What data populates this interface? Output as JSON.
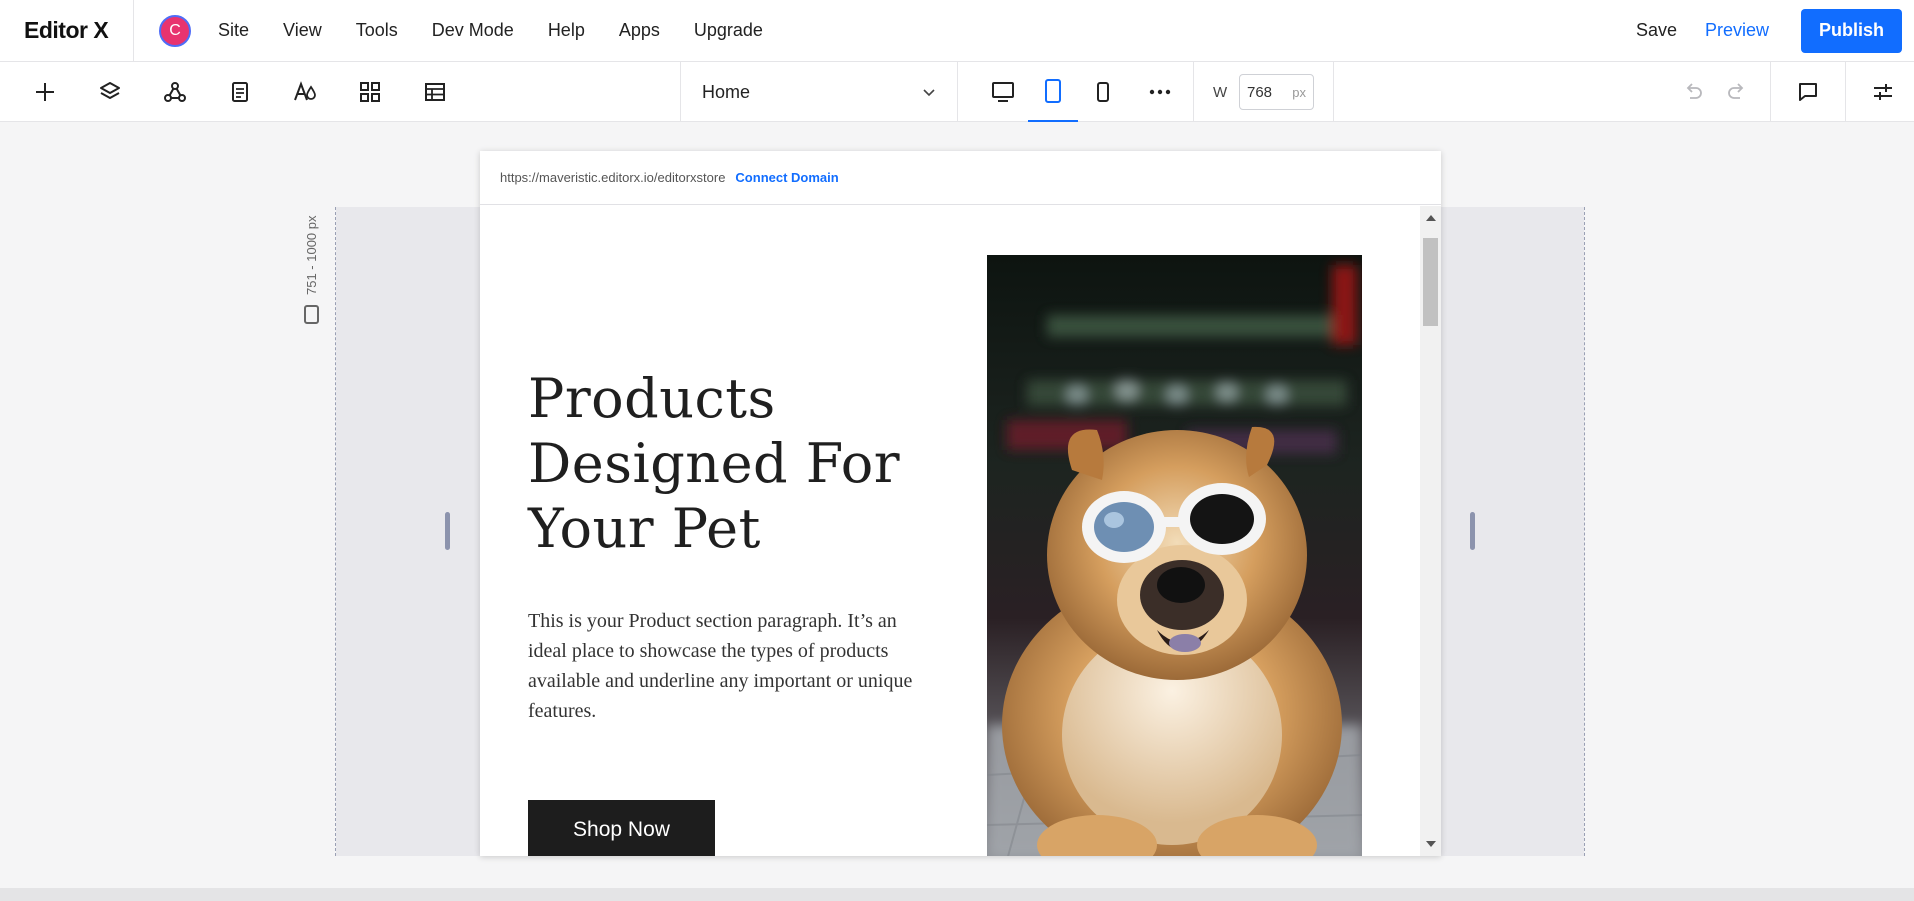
{
  "app": {
    "logo": "Editor X",
    "avatar_letter": "C"
  },
  "menu": [
    {
      "label": "Site"
    },
    {
      "label": "View"
    },
    {
      "label": "Tools"
    },
    {
      "label": "Dev Mode"
    },
    {
      "label": "Help"
    },
    {
      "label": "Apps"
    },
    {
      "label": "Upgrade"
    }
  ],
  "actions": {
    "save": "Save",
    "preview": "Preview",
    "publish": "Publish"
  },
  "toolbar": {
    "tools": [
      "plus-icon",
      "layers-icon",
      "connect-icon",
      "page-icon",
      "theme-icon",
      "apps-grid-icon",
      "table-icon"
    ],
    "page": "Home",
    "width_label": "W",
    "width_value": "768",
    "width_unit": "px"
  },
  "canvas": {
    "breakpoint_range": "751 - 1000 px",
    "url": "https://maveristic.editorx.io/editorxstore",
    "connect_domain": "Connect Domain"
  },
  "site": {
    "title_lines": [
      "Products",
      "Designed For",
      "Your Pet"
    ],
    "paragraph": "This is your Product section paragraph. It’s an ideal place to showcase the types of products available and underline any important or unique features.",
    "button": "Shop Now"
  },
  "colors": {
    "accent": "#116dff",
    "publish_bg": "#116dff",
    "avatar": "#e8336f",
    "button_bg": "#1d1d1d"
  }
}
